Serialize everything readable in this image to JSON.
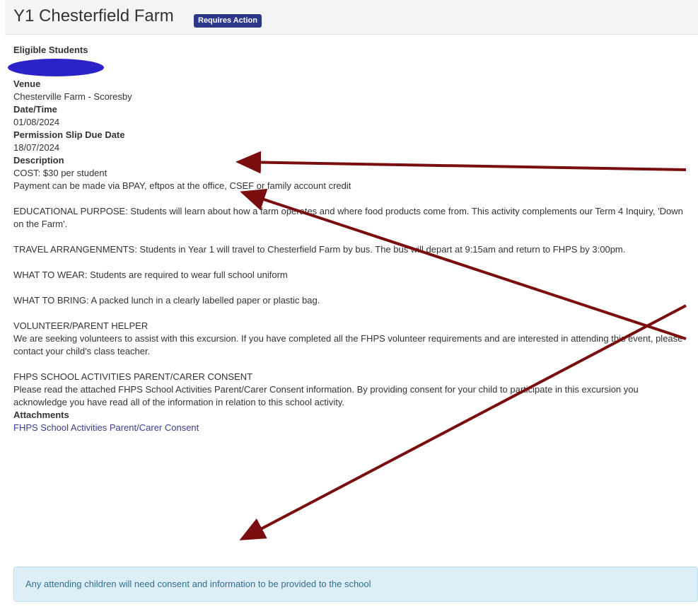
{
  "header": {
    "title": "Y1 Chesterfield Farm",
    "badge": "Requires Action"
  },
  "details": {
    "eligible_label": "Eligible Students",
    "venue_label": "Venue",
    "venue": "Chesterville Farm - Scoresby",
    "datetime_label": "Date/Time",
    "datetime": "01/08/2024",
    "due_label": "Permission Slip Due Date",
    "due": "18/07/2024",
    "description_label": "Description"
  },
  "description": {
    "cost": "COST: $30 per student",
    "payment": "Payment can be made via BPAY, eftpos at the office, CSEF or family account credit",
    "purpose": "EDUCATIONAL PURPOSE: Students will learn about how a farm operates and where food products come from. This activity complements our Term 4 Inquiry, 'Down on the Farm'.",
    "travel": "TRAVEL ARRANGENMENTS: Students in Year 1 will travel to Chesterfield Farm by bus. The bus will depart at 9:15am and return to FHPS by 3:00pm.",
    "wear": "WHAT TO WEAR: Students are required to wear full school uniform",
    "bring": "WHAT TO BRING: A packed lunch in a clearly labelled paper or plastic bag.",
    "volunteer_heading": "VOLUNTEER/PARENT HELPER",
    "volunteer_text": "We are seeking volunteers to assist with this excursion. If you have completed all the FHPS volunteer requirements and are interested in attending this event, please contact your child's class teacher.",
    "consent_heading": "FHPS SCHOOL ACTIVITIES PARENT/CARER CONSENT",
    "consent_text": "Please read the attached FHPS School Activities Parent/Carer Consent information. By providing consent for your child to participate in this excursion you acknowledge you have read all of the information in relation to this school activity."
  },
  "attachments": {
    "label": "Attachments",
    "link": "FHPS School Activities Parent/Carer Consent"
  },
  "info_box": "Any attending children will need consent and information to be provided to the school",
  "colors": {
    "badge": "#2d3787",
    "arrow": "#7a0e0e",
    "info_bg": "#ddeef6",
    "redaction": "#2b22c8"
  }
}
